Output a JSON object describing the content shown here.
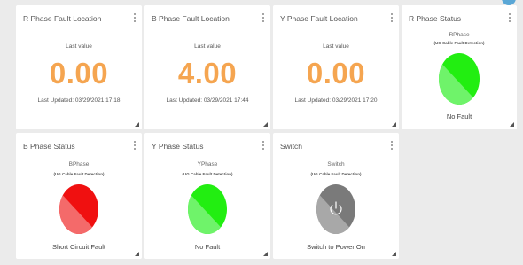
{
  "cards": {
    "r_fault": {
      "title": "R Phase Fault Location",
      "sub_label": "Last value",
      "value": "0.00",
      "updated": "Last Updated: 03/29/2021 17:18"
    },
    "b_fault": {
      "title": "B Phase Fault Location",
      "sub_label": "Last value",
      "value": "4.00",
      "updated": "Last Updated: 03/29/2021 17:44"
    },
    "y_fault": {
      "title": "Y Phase Fault Location",
      "sub_label": "Last value",
      "value": "0.00",
      "updated": "Last Updated: 03/29/2021 17:20"
    },
    "r_status": {
      "title": "R Phase Status",
      "device": "RPhase",
      "device_sub": "(UG Cable Fault Detection)",
      "status": "No Fault",
      "color_dark": "#22ee11",
      "color_light": "#6ff36a"
    },
    "b_status": {
      "title": "B Phase Status",
      "device": "BPhase",
      "device_sub": "(UG Cable Fault Detection)",
      "status": "Short Circuit Fault",
      "color_dark": "#f01010",
      "color_light": "#f46a6a"
    },
    "y_status": {
      "title": "Y Phase Status",
      "device": "YPhase",
      "device_sub": "(UG Cable Fault Detection)",
      "status": "No Fault",
      "color_dark": "#22ee11",
      "color_light": "#6ff36a"
    },
    "switch": {
      "title": "Switch",
      "device": "Switch",
      "device_sub": "(UG Cable Fault Detection)",
      "status": "Switch to Power On",
      "color_dark": "#7a7a7a",
      "color_light": "#a8a8a8",
      "icon": "power-icon"
    }
  },
  "colors": {
    "value": "#f5a550",
    "background": "#ebebeb",
    "card": "#ffffff"
  }
}
